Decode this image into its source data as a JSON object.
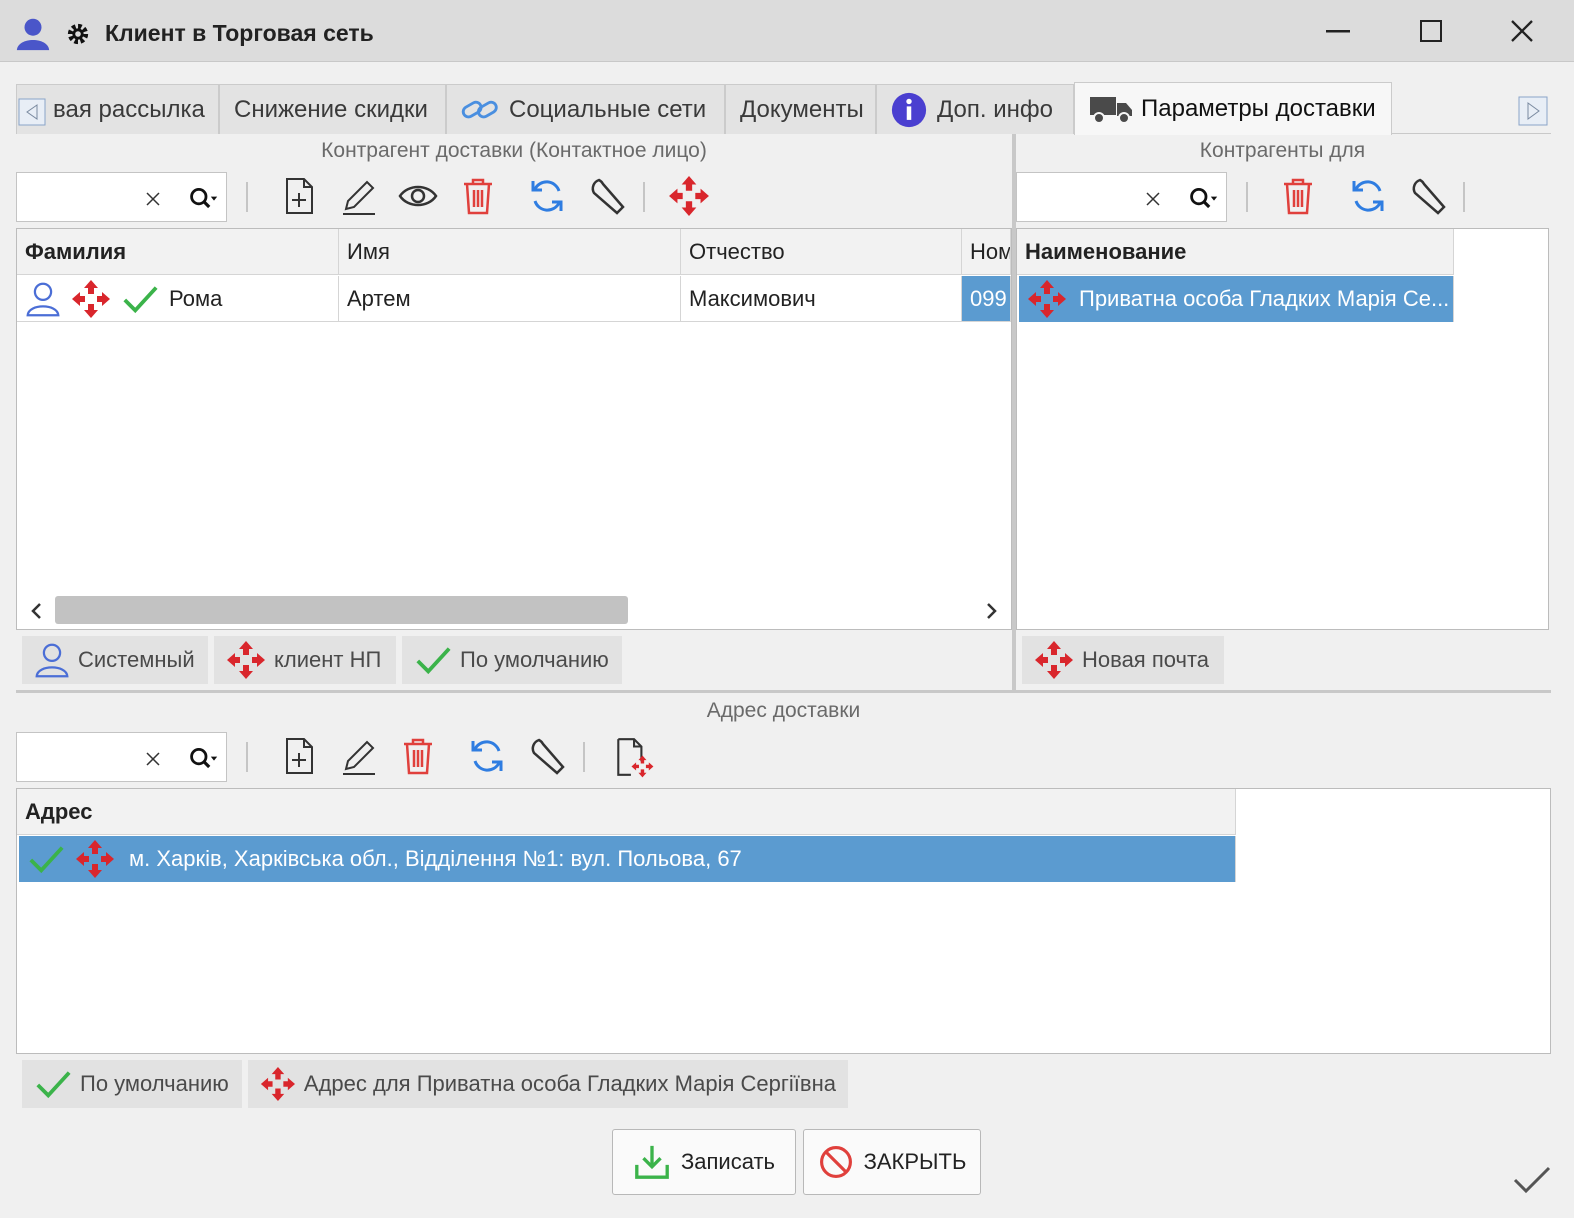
{
  "window": {
    "title": "Клиент в Торговая сеть",
    "icons": [
      "user-icon",
      "gear-icon"
    ],
    "controls": [
      "minimize",
      "maximize",
      "close"
    ]
  },
  "tabs": [
    {
      "label": "вая рассылка"
    },
    {
      "label": "Снижение скидки"
    },
    {
      "label": "Социальные сети",
      "icon": "link-icon"
    },
    {
      "label": "Документы"
    },
    {
      "label": "Доп. инфо",
      "icon": "info-icon"
    },
    {
      "label": "Параметры доставки",
      "icon": "truck-icon",
      "active": true
    }
  ],
  "left_panel": {
    "caption": "Контрагент доставки (Контактное лицо)",
    "search": {
      "value": ""
    },
    "columns": [
      "Фамилия",
      "Имя",
      "Отчество",
      "Ном"
    ],
    "rows": [
      {
        "icons": [
          "person-icon",
          "np-icon",
          "check-icon"
        ],
        "last_name": "Рома",
        "first_name": "Артем",
        "middle_name": "Максимович",
        "phone": "099"
      }
    ],
    "legend": [
      {
        "icon": "person-icon",
        "label": "Системный"
      },
      {
        "icon": "np-icon",
        "label": "клиент НП"
      },
      {
        "icon": "check-icon",
        "label": "По умолчанию"
      }
    ]
  },
  "right_panel": {
    "caption": "Контрагенты для",
    "search": {
      "value": ""
    },
    "columns": [
      "Наименование"
    ],
    "rows": [
      {
        "icon": "np-icon",
        "name": "Приватна особа Гладких Марія Се..."
      }
    ],
    "legend": [
      {
        "icon": "np-icon",
        "label": "Новая почта"
      }
    ]
  },
  "address_panel": {
    "caption": "Адрес доставки",
    "search": {
      "value": ""
    },
    "columns": [
      "Адрес"
    ],
    "rows": [
      {
        "icons": [
          "check-icon",
          "np-icon"
        ],
        "address": "м. Харків, Харківська обл., Відділення №1: вул. Польова, 67"
      }
    ],
    "legend": [
      {
        "icon": "check-icon",
        "label": "По умолчанию"
      },
      {
        "icon": "np-icon",
        "label": "Адрес для Приватна особа Гладких Марія Сергіївна"
      }
    ]
  },
  "buttons": {
    "save": "Записать",
    "close": "ЗАКРЫТЬ"
  },
  "colors": {
    "selection": "#5b9bd0",
    "np_red": "#d9262c",
    "check_green": "#3bb34a",
    "refresh_blue": "#2f7de1",
    "user_blue": "#4a56c9"
  }
}
